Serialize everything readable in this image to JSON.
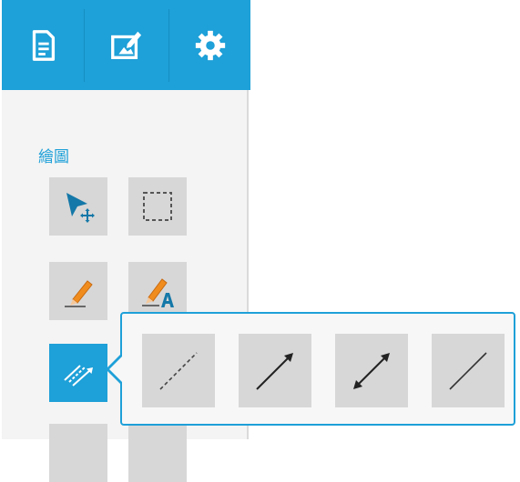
{
  "toolbar": {
    "buttons": [
      {
        "icon": "document-icon"
      },
      {
        "icon": "edit-image-icon"
      },
      {
        "icon": "gear-icon"
      }
    ],
    "accent_color": "#1ea0d8"
  },
  "section": {
    "label": "繪圖"
  },
  "tools": [
    {
      "icon": "select-move-icon"
    },
    {
      "icon": "marquee-select-icon"
    },
    {
      "icon": "pencil-icon"
    },
    {
      "icon": "pencil-text-icon"
    },
    {
      "icon": "line-tools-icon",
      "active": true
    }
  ],
  "flyout": {
    "items": [
      {
        "icon": "dashed-line-icon"
      },
      {
        "icon": "arrow-line-icon"
      },
      {
        "icon": "double-arrow-line-icon"
      },
      {
        "icon": "straight-line-icon"
      }
    ]
  }
}
